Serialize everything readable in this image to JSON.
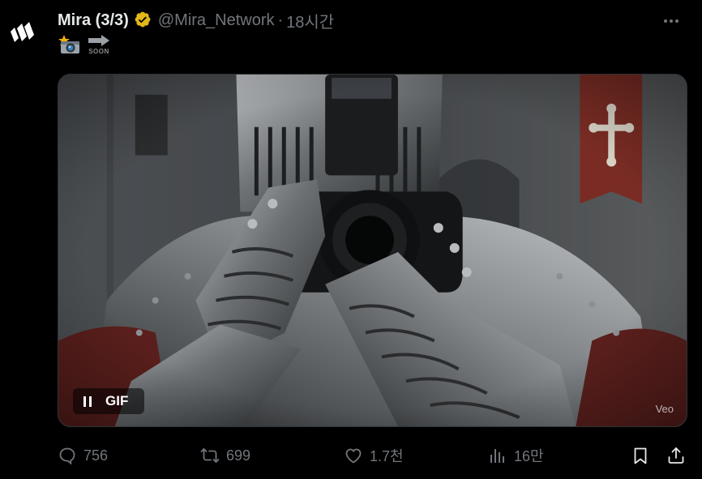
{
  "author": {
    "display_name": "Mira (3/3)",
    "handle": "@Mira_Network",
    "separator": "·",
    "time": "18시간",
    "verified_icon": "gold-verified-badge-icon"
  },
  "tweet": {
    "emoji_icon": "camera-with-flash-icon",
    "arrow_icon": "soon-arrow-icon",
    "soon_text": "SOON"
  },
  "media": {
    "type_label": "GIF",
    "watermark": "Veo",
    "pause_icon": "pause-icon",
    "description_icon": "knight-with-camera-scene"
  },
  "actions": {
    "replies": "756",
    "reposts": "699",
    "likes": "1.7천",
    "views": "16만"
  },
  "colors": {
    "background": "#000000",
    "primary_text": "#e7e9ea",
    "secondary_text": "#71767b",
    "verified_gold": "#e2b719"
  }
}
